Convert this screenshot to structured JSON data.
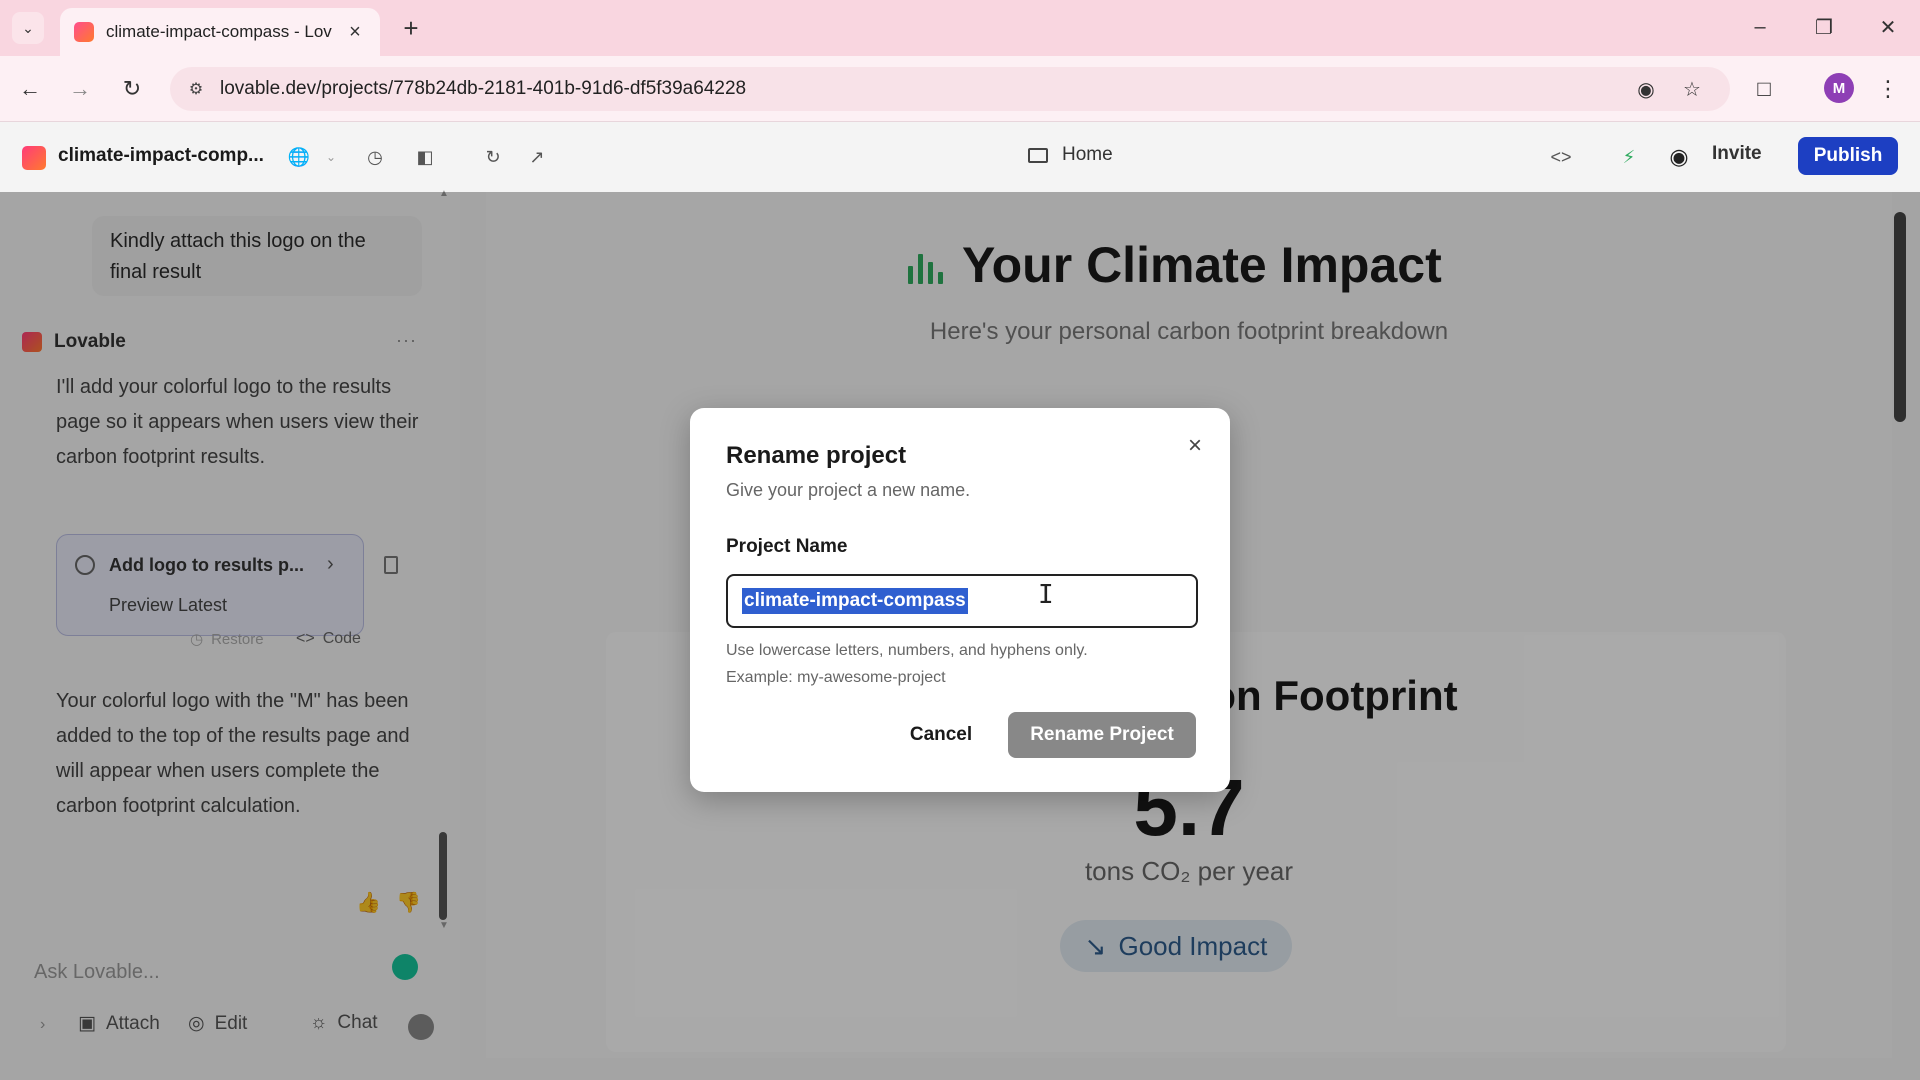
{
  "browser": {
    "tab_title": "climate-impact-compass - Lova",
    "url": "lovable.dev/projects/778b24db-2181-401b-91d6-df5f39a64228",
    "profile_initial": "M"
  },
  "appbar": {
    "project_name": "climate-impact-comp...",
    "home_label": "Home",
    "invite_label": "Invite",
    "publish_label": "Publish"
  },
  "chat": {
    "user_message_line1": "Kindly attach this logo on the",
    "user_message_line2": "final result",
    "assistant_name": "Lovable",
    "assistant_message_1": "I'll add your colorful logo to the results page so it appears when users view their carbon footprint results.",
    "version_card": {
      "title": "Add logo to results p...",
      "preview_label": "Preview Latest"
    },
    "restore_label": "Restore",
    "code_label": "Code",
    "assistant_message_2": "Your colorful logo with the \"M\" has been added to the top of the results page and will appear when users complete the carbon footprint calculation.",
    "input_placeholder": "Ask Lovable...",
    "tools": {
      "attach": "Attach",
      "edit": "Edit",
      "chat": "Chat"
    }
  },
  "preview": {
    "title": "Your Climate Impact",
    "subtitle": "Here's your personal carbon footprint breakdown",
    "card_title_visible": "on Footprint",
    "value_visible": "5.7",
    "unit": "tons CO₂ per year",
    "badge": "Good Impact"
  },
  "modal": {
    "title": "Rename project",
    "description": "Give your project a new name.",
    "field_label": "Project Name",
    "field_value": "climate-impact-compass",
    "hint_line1": "Use lowercase letters, numbers, and hyphens only.",
    "hint_line2": "Example: my-awesome-project",
    "cancel_label": "Cancel",
    "rename_label": "Rename Project"
  },
  "colors": {
    "publish_bg": "#1d3fc2",
    "selection": "#2f5fd0",
    "accent_green": "#2eaa5e",
    "tab_bar": "#f9d6e0"
  },
  "icons": {
    "tabbar": [
      "chevron-down-icon",
      "close-icon",
      "plus-icon",
      "minimize-icon",
      "restore-icon",
      "close-window-icon"
    ],
    "nav": [
      "back-icon",
      "forward-icon",
      "reload-icon",
      "site-info-icon",
      "eye-off-icon",
      "star-icon",
      "extensions-icon",
      "kebab-menu-icon"
    ],
    "appbar": [
      "globe-icon",
      "history-icon",
      "sidebar-toggle-icon",
      "refresh-icon",
      "external-link-icon",
      "monitor-icon",
      "code-icon",
      "lightning-icon",
      "github-icon"
    ]
  }
}
